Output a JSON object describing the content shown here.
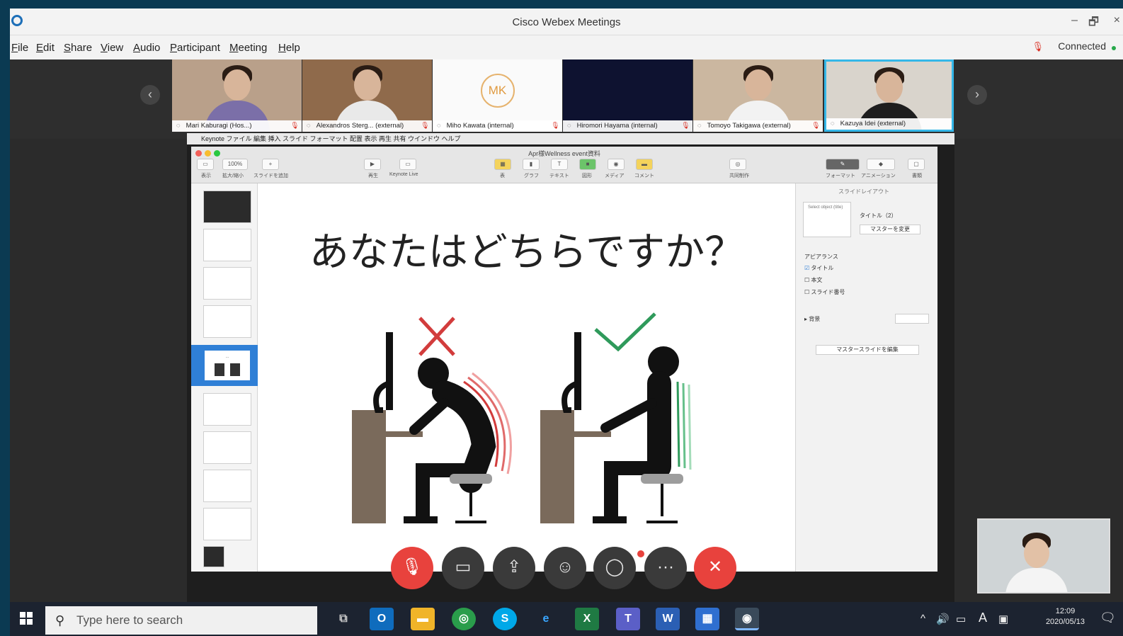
{
  "window": {
    "title": "Cisco Webex Meetings",
    "controls": {
      "minimize": "–",
      "restore": "🗗",
      "close": "×"
    }
  },
  "menu": [
    "File",
    "Edit",
    "Share",
    "View",
    "Audio",
    "Participant",
    "Meeting",
    "Help"
  ],
  "status": {
    "connection": "Connected"
  },
  "participants": [
    {
      "name": "Mari Kaburagi (Hos...)",
      "bg": "#b9a08a",
      "shirt": "#7b6fa8"
    },
    {
      "name": "Alexandros Sterg... (external)",
      "bg": "#8f6a4b",
      "shirt": "#e9e9e9"
    },
    {
      "name": "Miho Kawata (internal)",
      "initials": "MK"
    },
    {
      "name": "Hiromori Hayama (internal)",
      "bg": "#0e1230"
    },
    {
      "name": "Tomoyo Takigawa (external)",
      "bg": "#cbb7a0",
      "shirt": "#f2f2f2"
    },
    {
      "name": "Kazuya Idei (external)",
      "bg": "#d9d4cc",
      "shirt": "#1e1e1e"
    }
  ],
  "mac_menubar": "  Keynote   ファイル   編集   挿入   スライド   フォーマット   配置   表示   再生   共有   ウインドウ   ヘルプ",
  "keynote": {
    "document_title": "Apr様Wellness event資料",
    "zoom": "100%",
    "toolbar_labels": {
      "view": "表示",
      "zoom": "拡大/縮小",
      "add_slide": "スライドを追加",
      "play": "再生",
      "keynote_live": "Keynote Live",
      "table": "表",
      "chart": "グラフ",
      "text": "テキスト",
      "shape": "図形",
      "media": "メディア",
      "comment": "コメント",
      "collaborate": "共同制作",
      "format": "フォーマット",
      "animate": "アニメーション",
      "document": "書類"
    },
    "slide_title": "あなたはどちらですか？",
    "inspector": {
      "header": "スライドレイアウト",
      "layout_name": "タイトル（2）",
      "layout_preview": "Select object (title)",
      "change_master": "マスターを変更",
      "appearance": "アピアランス",
      "options": [
        {
          "label": "タイトル",
          "checked": true
        },
        {
          "label": "本文",
          "checked": false
        },
        {
          "label": "スライド番号",
          "checked": false
        }
      ],
      "background": "背景",
      "edit_master": "マスタースライドを編集"
    }
  },
  "taskbar": {
    "search_placeholder": "Type here to search",
    "time": "12:09",
    "date": "2020/05/13",
    "ime": "A"
  }
}
